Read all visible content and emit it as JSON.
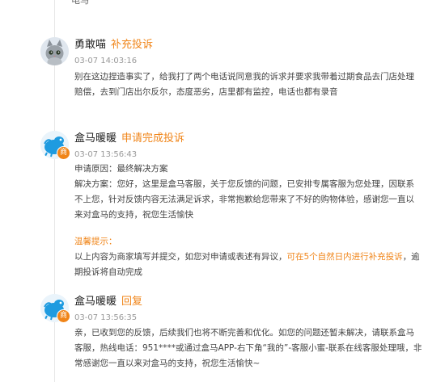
{
  "top_remnant": "电马",
  "entries": [
    {
      "name": "勇敢喵",
      "action": "补充投诉",
      "time": "03-07 14:03:16",
      "text": "别在这边捏造事实了，给我打了两个电话说同意我的诉求并要求我带着过期食品去门店处理赔偿，去到门店出尔反尔，态度恶劣，店里都有监控，电话也都有录音"
    },
    {
      "name": "盒马暖暖",
      "action": "申请完成投诉",
      "time": "03-07 13:56:43",
      "badge": "商",
      "reason_label": "申请原因：",
      "reason": "最终解决方案",
      "solution_label": "解决方案：",
      "solution": "您好，这里是盒马客服，关于您反馈的问题，已安排专属客服为您处理，因联系不上您，针对反馈内容无法满足诉求，非常抱歉给您带来了不好的购物体验，感谢您一直以来对盒马的支持，祝您生活愉快",
      "tip_title": "温馨提示：",
      "tip_before": "以上内容为商家填写并提交，如您对申请或表述有异议，",
      "tip_highlight": "可在5个自然日内进行补充投诉",
      "tip_after": "，逾期投诉将自动完成"
    },
    {
      "name": "盒马暖暖",
      "action": "回复",
      "time": "03-07 13:56:35",
      "badge": "商",
      "text": "亲，已收到您的反馈，后续我们也将不断完善和优化。如您的问题还暂未解决，请联系盒马客服，热线电话：951****或通过盒马APP-右下角“我的”-客服小蜜-联系在线客服处理哦，非常感谢您一直以来对盒马的支持，祝您生活愉快~"
    }
  ]
}
